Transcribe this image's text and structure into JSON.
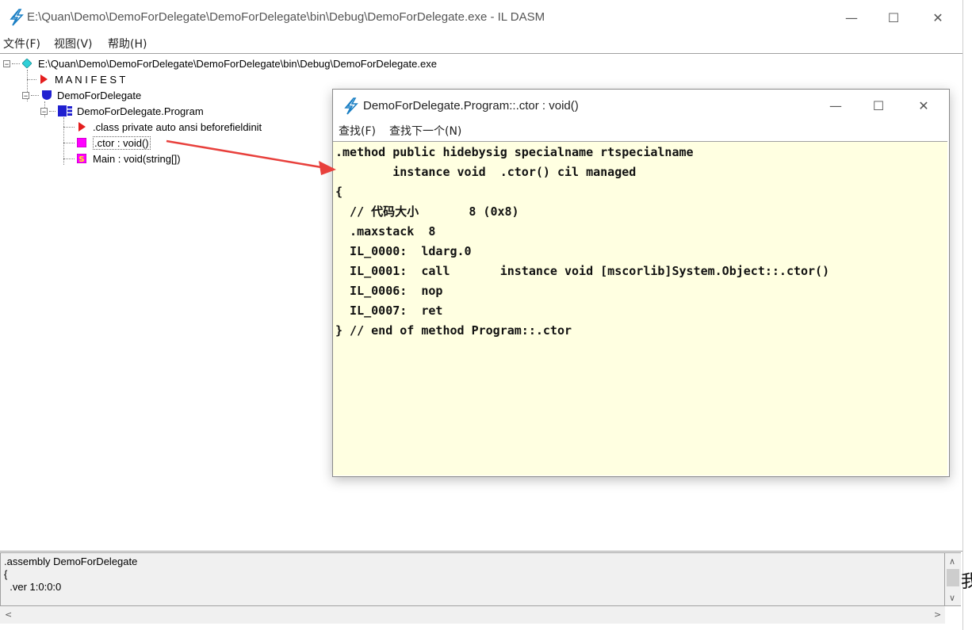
{
  "window": {
    "title": "E:\\Quan\\Demo\\DemoForDelegate\\DemoForDelegate\\bin\\Debug\\DemoForDelegate.exe - IL DASM",
    "minimize": "—",
    "maximize": "☐",
    "close": "✕",
    "icon": "lightning-icon"
  },
  "menu": {
    "file": "文件(F)",
    "view": "视图(V)",
    "help": "帮助(H)"
  },
  "tree": {
    "root": "E:\\Quan\\Demo\\DemoForDelegate\\DemoForDelegate\\bin\\Debug\\DemoForDelegate.exe",
    "manifest": "M A N I F E S T",
    "namespace": "DemoForDelegate",
    "class": "DemoForDelegate.Program",
    "class_info": ".class private auto ansi beforefieldinit",
    "ctor": ".ctor : void()",
    "main": "Main : void(string[])"
  },
  "info_panel": {
    "lines": [
      ".assembly DemoForDelegate",
      "{",
      "  .ver 1:0:0:0"
    ]
  },
  "dialog": {
    "title": "DemoForDelegate.Program::.ctor : void()",
    "menu_find": "查找(F)",
    "menu_find_next": "查找下一个(N)",
    "minimize": "—",
    "maximize": "☐",
    "close": "✕",
    "code": [
      ".method public hidebysig specialname rtspecialname",
      "        instance void  .ctor() cil managed",
      "{",
      "  // 代码大小       8 (0x8)",
      "  .maxstack  8",
      "  IL_0000:  ldarg.0",
      "  IL_0001:  call       instance void [mscorlib]System.Object::.ctor()",
      "  IL_0006:  nop",
      "  IL_0007:  ret",
      "} // end of method Program::.ctor"
    ]
  },
  "side_text": "我",
  "colors": {
    "code_bg": "#ffffe1",
    "arrow": "#e8403c",
    "lightning": "#1a7fc4"
  }
}
